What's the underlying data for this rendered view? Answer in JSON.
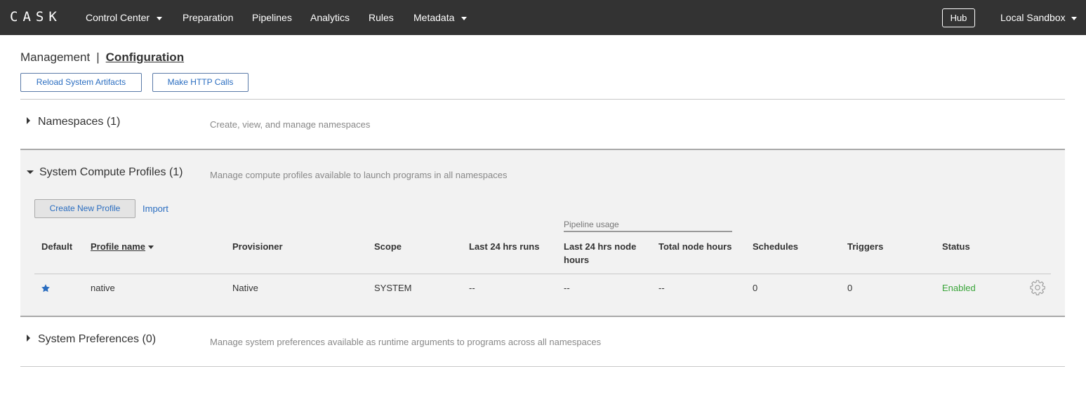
{
  "nav": {
    "brand": "CASK",
    "items": [
      {
        "label": "Control Center",
        "dropdown": true
      },
      {
        "label": "Preparation",
        "dropdown": false
      },
      {
        "label": "Pipelines",
        "dropdown": false
      },
      {
        "label": "Analytics",
        "dropdown": false
      },
      {
        "label": "Rules",
        "dropdown": false
      },
      {
        "label": "Metadata",
        "dropdown": true
      }
    ],
    "hub": "Hub",
    "sandbox": "Local Sandbox"
  },
  "breadcrumb": {
    "parent": "Management",
    "separator": "|",
    "current": "Configuration"
  },
  "actions": {
    "reload": "Reload System Artifacts",
    "http": "Make HTTP Calls"
  },
  "sections": {
    "namespaces": {
      "title": "Namespaces (1)",
      "description": "Create, view, and manage namespaces",
      "expanded": false
    },
    "profiles": {
      "title": "System Compute Profiles (1)",
      "description": "Manage compute profiles available to launch programs in all namespaces",
      "expanded": true
    },
    "preferences": {
      "title": "System Preferences (0)",
      "description": "Manage system preferences available as runtime arguments to programs across all namespaces",
      "expanded": false
    }
  },
  "profiles_panel": {
    "create_button": "Create New Profile",
    "import_link": "Import",
    "group_header": "Pipeline usage",
    "columns": {
      "default": "Default",
      "profile_name": "Profile name",
      "provisioner": "Provisioner",
      "scope": "Scope",
      "last_runs": "Last 24 hrs runs",
      "last_node_hours": "Last 24 hrs node hours",
      "total_node_hours": "Total node hours",
      "schedules": "Schedules",
      "triggers": "Triggers",
      "status": "Status"
    },
    "rows": [
      {
        "is_default": true,
        "name": "native",
        "provisioner": "Native",
        "scope": "SYSTEM",
        "last_runs": "--",
        "last_node_hours": "--",
        "total_node_hours": "--",
        "schedules": "0",
        "triggers": "0",
        "status": "Enabled"
      }
    ]
  },
  "colors": {
    "nav_bg": "#333333",
    "accent": "#2a6dc0",
    "enabled": "#3aa53a",
    "panel_bg": "#f2f2f2"
  }
}
